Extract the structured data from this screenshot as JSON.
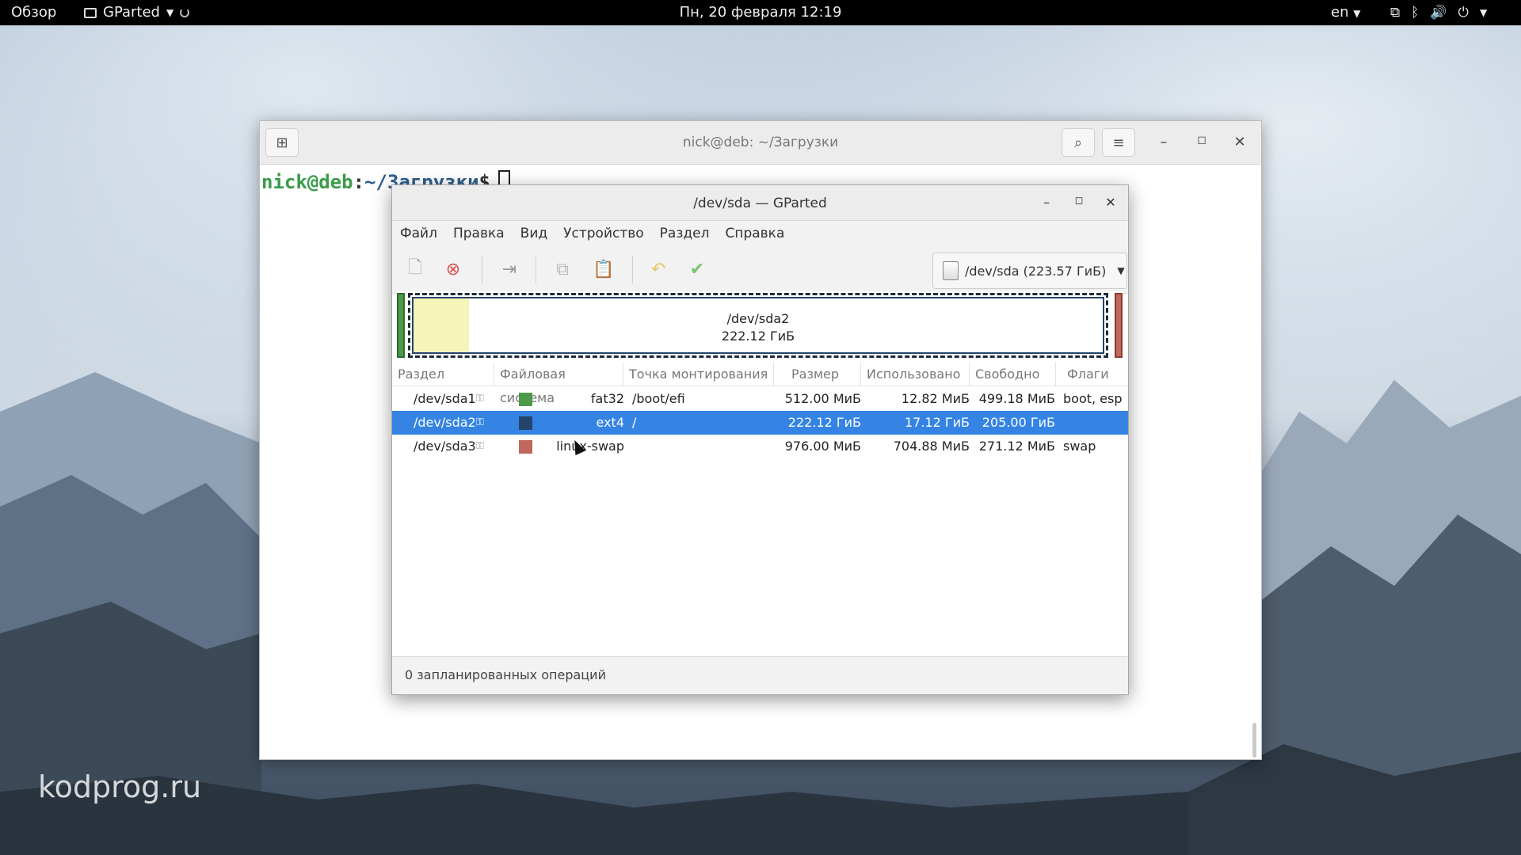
{
  "topbar": {
    "overview": "Обзор",
    "app_name": "GParted",
    "clock": "Пн, 20 февраля  12:19",
    "lang": "en",
    "status_icons": [
      "network-icon",
      "bluetooth-icon",
      "volume-icon",
      "power-icon"
    ]
  },
  "terminal": {
    "title": "nick@deb: ~/Загрузки",
    "prompt_user": "nick@deb",
    "prompt_sep": ":",
    "prompt_path": "~/Загрузки",
    "prompt_symbol": "$"
  },
  "gparted": {
    "title": "/dev/sda — GParted",
    "menu": [
      "Файл",
      "Правка",
      "Вид",
      "Устройство",
      "Раздел",
      "Справка"
    ],
    "device_selector": "/dev/sda (223.57 ГиБ)",
    "diskmap": {
      "selected_name": "/dev/sda2",
      "selected_size": "222.12 ГиБ",
      "selected_used_fraction": 0.08
    },
    "columns": [
      "Раздел",
      "Файловая система",
      "Точка монтирования",
      "Размер",
      "Использовано",
      "Свободно",
      "Флаги"
    ],
    "rows": [
      {
        "partition": "/dev/sda1",
        "fs": "fat32",
        "mount": "/boot/efi",
        "size": "512.00 МиБ",
        "used": "12.82 МиБ",
        "free": "499.18 МиБ",
        "flags": "boot, esp",
        "color": "#4c9a49"
      },
      {
        "partition": "/dev/sda2",
        "fs": "ext4",
        "mount": "/",
        "size": "222.12 ГиБ",
        "used": "17.12 ГиБ",
        "free": "205.00 ГиБ",
        "flags": "",
        "color": "#26436a"
      },
      {
        "partition": "/dev/sda3",
        "fs": "linux-swap",
        "mount": "",
        "size": "976.00 МиБ",
        "used": "704.88 МиБ",
        "free": "271.12 МиБ",
        "flags": "swap",
        "color": "#c0685c"
      }
    ],
    "selected_row": 1,
    "status": "0 запланированных операций"
  },
  "watermark": "kodprog.ru",
  "colors": {
    "selection": "#3584e4",
    "fat32": "#4c9a49",
    "ext4": "#26436a",
    "swap": "#c0685c"
  }
}
